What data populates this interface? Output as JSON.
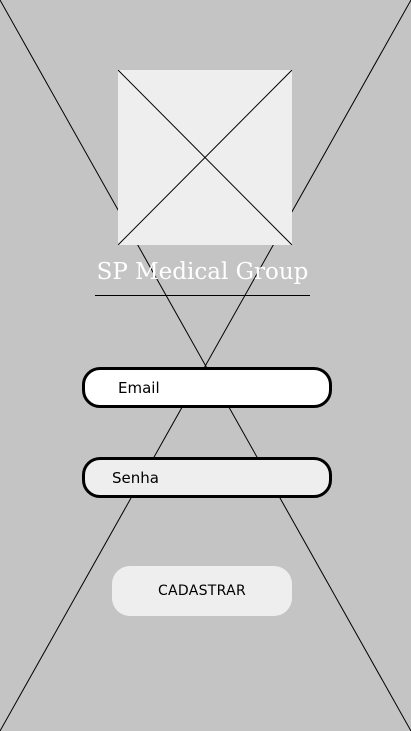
{
  "app": {
    "title": "SP Medical Group"
  },
  "logo": {
    "icon": "image-placeholder-icon"
  },
  "form": {
    "email_placeholder": "Email",
    "senha_placeholder": "Senha",
    "submit_label": "CADASTRAR"
  },
  "colors": {
    "background": "#c4c4c4",
    "placeholder_fill": "#eeeeee",
    "email_field_fill": "#ffffff",
    "field_border": "#000000",
    "title_text": "#ffffff"
  }
}
